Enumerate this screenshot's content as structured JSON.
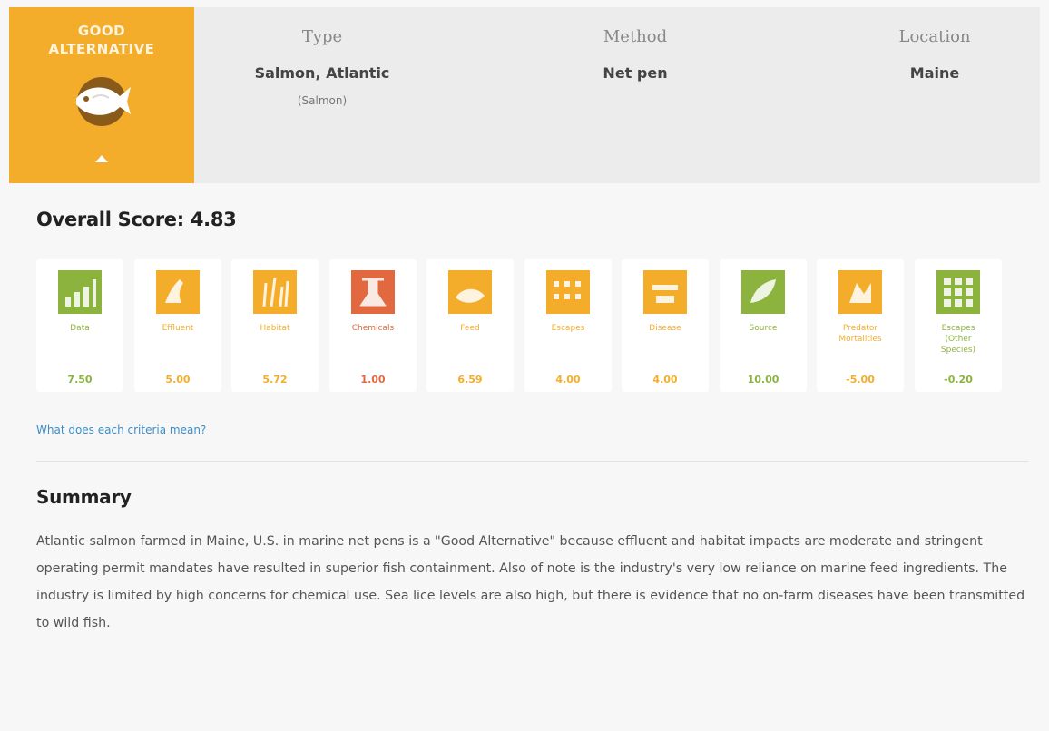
{
  "rating": {
    "label": "GOOD\nALTERNATIVE",
    "icon": "fish-icon",
    "color": "#f4ad2b"
  },
  "meta": {
    "type": {
      "heading": "Type",
      "value": "Salmon, Atlantic",
      "sub": "(Salmon)"
    },
    "method": {
      "heading": "Method",
      "value": "Net pen"
    },
    "location": {
      "heading": "Location",
      "value": "Maine"
    }
  },
  "overall": "Overall Score: 4.83",
  "criteria": [
    {
      "name": "Data",
      "score": "7.50",
      "color": "#8db33f",
      "icon": "bar-chart-icon"
    },
    {
      "name": "Effluent",
      "score": "5.00",
      "color": "#f4ad2b",
      "icon": "effluent-icon"
    },
    {
      "name": "Habitat",
      "score": "5.72",
      "color": "#f4ad2b",
      "icon": "habitat-icon"
    },
    {
      "name": "Chemicals",
      "score": "1.00",
      "color": "#e2683f",
      "icon": "chemicals-icon"
    },
    {
      "name": "Feed",
      "score": "6.59",
      "color": "#f4ad2b",
      "icon": "feed-icon"
    },
    {
      "name": "Escapes",
      "score": "4.00",
      "color": "#f4ad2b",
      "icon": "escapes-icon"
    },
    {
      "name": "Disease",
      "score": "4.00",
      "color": "#f4ad2b",
      "icon": "disease-icon"
    },
    {
      "name": "Source",
      "score": "10.00",
      "color": "#8db33f",
      "icon": "source-icon"
    },
    {
      "name": "Predator\nMortalities",
      "score": "-5.00",
      "color": "#f4ad2b",
      "icon": "predator-icon"
    },
    {
      "name": "Escapes\n(Other\nSpecies)",
      "score": "-0.20",
      "color": "#8db33f",
      "icon": "escapes-other-species-icon"
    }
  ],
  "criteria_link": "What does each criteria mean?",
  "summary": {
    "title": "Summary",
    "text": "Atlantic salmon farmed in Maine, U.S. in marine net pens is a \"Good Alternative\" because effluent and habitat impacts are moderate and stringent operating permit mandates have resulted in superior fish containment. Also of note is the industry's very low reliance on marine feed ingredients. The industry is limited by high concerns for chemical use. Sea lice levels are also high, but there is evidence that no on-farm diseases have been transmitted to wild fish."
  }
}
